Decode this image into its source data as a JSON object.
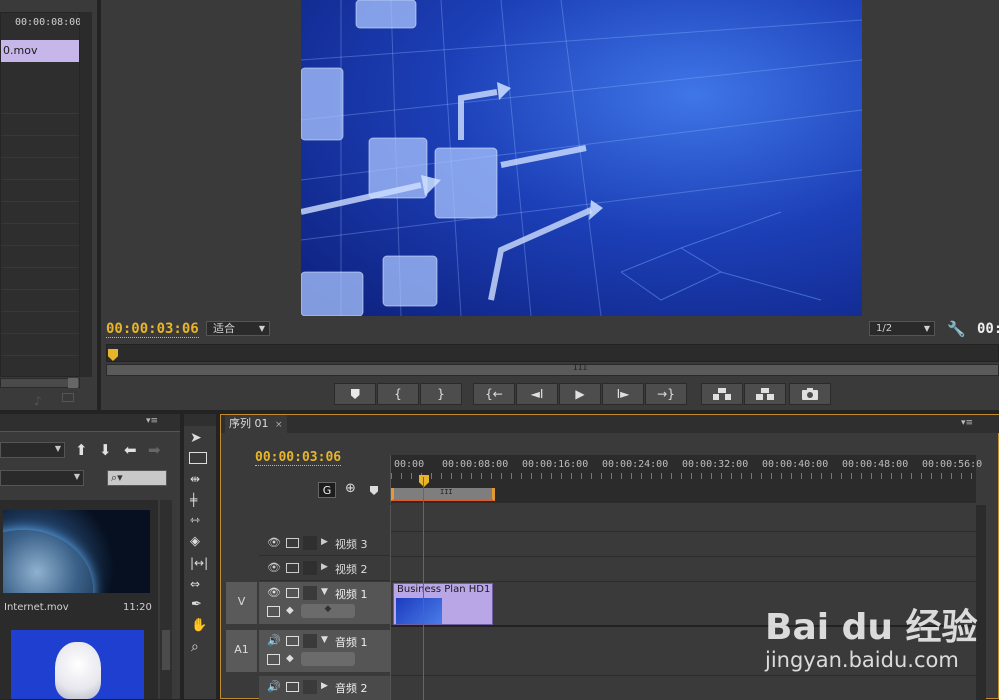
{
  "project_panel": {
    "duration_header": "00:00:08:00",
    "selected_file": "0.mov",
    "items": [
      {
        "name": "Internet.mov",
        "duration": "11:20"
      }
    ]
  },
  "program_monitor": {
    "timecode": "00:00:03:06",
    "fit_label": "适合",
    "resolution": "1/2",
    "right_timecode": "00:",
    "scroll_marker": "III"
  },
  "transport": {
    "add_marker": "add-marker",
    "in": "{",
    "out": "}",
    "go_in": "{←",
    "step_back": "◄I",
    "play": "▶",
    "step_forward": "I►",
    "go_out": "→}",
    "lift": "lift",
    "extract": "extract",
    "export_frame": "camera"
  },
  "timeline": {
    "tab_label": "序列",
    "tab_number": "01",
    "timecode": "00:00:03:06",
    "ruler": [
      "00:00",
      "00:00:08:00",
      "00:00:16:00",
      "00:00:24:00",
      "00:00:32:00",
      "00:00:40:00",
      "00:00:48:00",
      "00:00:56:0"
    ],
    "work_area_marker": "III",
    "tracks": [
      {
        "id": "v3",
        "label": "视频 3"
      },
      {
        "id": "v2",
        "label": "视频 2"
      },
      {
        "id": "v1",
        "label": "视频 1",
        "target": "V"
      },
      {
        "id": "a1",
        "label": "音频 1",
        "target": "A1"
      },
      {
        "id": "a2",
        "label": "音频 2"
      }
    ],
    "clip": {
      "title": "Business Plan HD1"
    }
  },
  "watermark": {
    "brand": "Bai du 经验",
    "url": "jingyan.baidu.com"
  },
  "colors": {
    "accent_timecode": "#e8b52a",
    "clip_video": "#b9a6e6",
    "playhead": "#d33a2c",
    "work_area": "#e39a33"
  }
}
